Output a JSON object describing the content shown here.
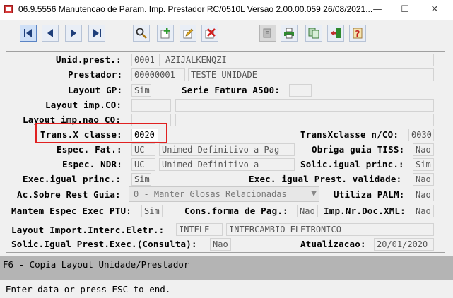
{
  "window": {
    "title": "06.9.5556 Manutencao  de Param. Imp. Prestador RC/0510L Versao 2.00.00.059 26/08/2021...",
    "minimize": "—",
    "maximize": "☐",
    "close": "✕"
  },
  "toolbar": {
    "buttons": [
      "first-record",
      "prev-record",
      "next-record",
      "last-record",
      "search",
      "add",
      "edit",
      "delete",
      "filter",
      "print",
      "copy",
      "exit",
      "help"
    ]
  },
  "form": {
    "unid_prest_label": "Unid.prest.:",
    "unid_prest_code": "0001",
    "unid_prest_name": "AZIJALKENQZI",
    "prestador_label": "Prestador:",
    "prestador_code": "00000001",
    "prestador_name": "TESTE UNIDADE",
    "layout_gp_label": "Layout GP:",
    "layout_gp_value": "Sim",
    "serie_fatura_label": "Serie Fatura A500:",
    "serie_fatura_value": "",
    "layout_imp_co_label": "Layout imp.CO:",
    "layout_imp_co_code": "",
    "layout_imp_co_desc": "",
    "layout_imp_nao_co_label": "Layout imp.nao CO:",
    "layout_imp_nao_co_code": "",
    "layout_imp_nao_co_desc": "",
    "trans_x_classe_label": "Trans.X classe:",
    "trans_x_classe_value": "0020",
    "transxclasse_nco_label": "TransXclasse n/CO:",
    "transxclasse_nco_value": "0030",
    "espec_fat_label": "Espec. Fat.:",
    "espec_fat_code": "UC",
    "espec_fat_desc": "Unimed Definitivo a Pag",
    "obriga_guia_label": "Obriga guia TISS:",
    "obriga_guia_value": "Nao",
    "espec_ndr_label": "Espec. NDR:",
    "espec_ndr_code": "UC",
    "espec_ndr_desc": "Unimed Definitivo a",
    "solic_igual_princ_label": "Solic.igual princ.:",
    "solic_igual_princ_value": "Sim",
    "exec_igual_princ_label": "Exec.igual princ.:",
    "exec_igual_princ_value": "Sim",
    "exec_igual_prest_label": "Exec. igual Prest. validade:",
    "exec_igual_prest_value": "Nao",
    "ac_sobre_rest_label": "Ac.Sobre Rest Guia:",
    "ac_sobre_rest_value": "0 - Manter Glosas Relacionadas",
    "utiliza_palm_label": "Utiliza PALM:",
    "utiliza_palm_value": "Nao",
    "mantem_espec_label": "Mantem Espec Exec PTU:",
    "mantem_espec_value": "Sim",
    "cons_forma_label": "Cons.forma de Pag.:",
    "cons_forma_value": "Nao",
    "imp_nr_doc_label": "Imp.Nr.Doc.XML:",
    "imp_nr_doc_value": "Nao",
    "layout_import_label": "Layout Import.Interc.Eletr.:",
    "layout_import_code": "INTELE",
    "layout_import_desc": "INTERCAMBIO ELETRONICO",
    "solic_igual_prest_exec_label": "Solic.Igual Prest.Exec.(Consulta):",
    "solic_igual_prest_exec_value": "Nao",
    "atualizacao_label": "Atualizacao:",
    "atualizacao_value": "20/01/2020"
  },
  "status": {
    "hint": "F6 - Copia Layout Unidade/Prestador",
    "message": "Enter data or press ESC to end."
  },
  "colors": {
    "highlight": "#e02020",
    "status_bar": "#b4b4b4"
  }
}
